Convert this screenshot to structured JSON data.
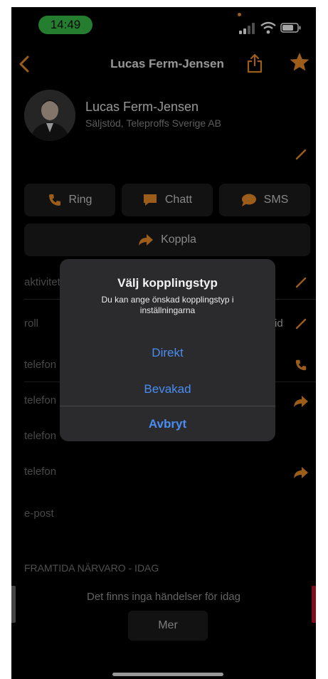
{
  "status_bar": {
    "time": "14:49"
  },
  "nav": {
    "title": "Lucas Ferm-Jensen"
  },
  "contact": {
    "name": "Lucas Ferm-Jensen",
    "subtitle": "Säljstöd, Teleproffs Sverige AB"
  },
  "actions": {
    "ring": "Ring",
    "chatt": "Chatt",
    "sms": "SMS",
    "koppla": "Koppla"
  },
  "fields": [
    {
      "label": "aktivitet",
      "value": ""
    },
    {
      "label": "roll",
      "value": "id"
    },
    {
      "label": "telefon",
      "value": ""
    },
    {
      "label": "telefon",
      "value": ""
    },
    {
      "label": "telefon",
      "value": ""
    },
    {
      "label": "telefon",
      "value": ""
    },
    {
      "label": "e-post",
      "value": ""
    }
  ],
  "section": {
    "title": "FRAMTIDA NÄRVARO - IDAG",
    "empty_text": "Det finns inga händelser för idag",
    "more_label": "Mer"
  },
  "dialog": {
    "title": "Välj kopplingstyp",
    "message": "Du kan ange önskad kopplingstyp i inställningarna",
    "options": [
      "Direkt",
      "Bevakad"
    ],
    "cancel": "Avbryt"
  },
  "colors": {
    "accent": "#f0902a",
    "link": "#4a8df0",
    "status_pill": "#3ac24a",
    "background": "#000000",
    "button_bg": "#1c1c1e",
    "dialog_bg": "#2b2b2d"
  },
  "icons": [
    "back-chevron-icon",
    "share-icon",
    "star-icon",
    "edit-icon",
    "phone-icon",
    "chat-icon",
    "sms-icon",
    "forward-icon",
    "wifi-icon",
    "battery-icon",
    "signal-icon"
  ]
}
